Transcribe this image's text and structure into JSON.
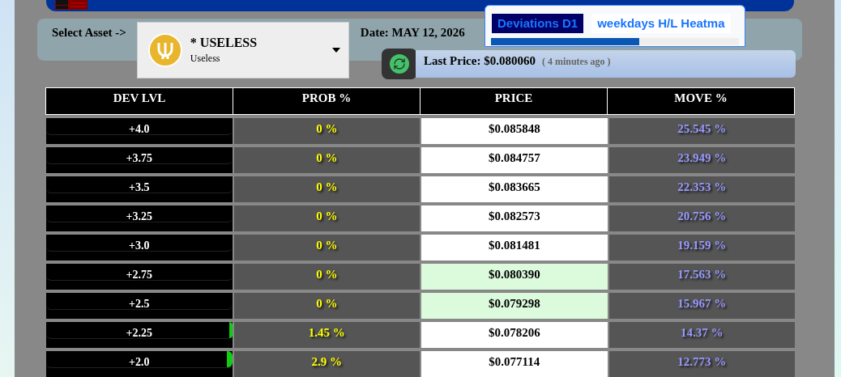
{
  "asset_selector": {
    "label": "Select Asset ->",
    "symbol": "* USELESS",
    "name": "Useless"
  },
  "date": "Date: MAY 12, 2026",
  "tabs": [
    {
      "label": "Deviations D1",
      "selected": true
    },
    {
      "label": "weekdays H/L Heatma",
      "selected": false
    }
  ],
  "last_price": {
    "label": "Last Price: $0.080060",
    "age": "( 4 minutes ago )"
  },
  "table": {
    "columns": [
      "DEV LVL",
      "PROB %",
      "PRICE",
      "MOVE %"
    ],
    "rows": [
      {
        "dev": "+4.0",
        "prob": "0 %",
        "price": "$0.085848",
        "highlighted": false,
        "move": "25.545 %"
      },
      {
        "dev": "+3.75",
        "prob": "0 %",
        "price": "$0.084757",
        "highlighted": false,
        "move": "23.949 %"
      },
      {
        "dev": "+3.5",
        "prob": "0 %",
        "price": "$0.083665",
        "highlighted": false,
        "move": "22.353 %"
      },
      {
        "dev": "+3.25",
        "prob": "0 %",
        "price": "$0.082573",
        "highlighted": false,
        "move": "20.756 %"
      },
      {
        "dev": "+3.0",
        "prob": "0 %",
        "price": "$0.081481",
        "highlighted": false,
        "move": "19.159 %"
      },
      {
        "dev": "+2.75",
        "prob": "0 %",
        "price": "$0.080390",
        "highlighted": true,
        "move": "17.563 %"
      },
      {
        "dev": "+2.5",
        "prob": "0 %",
        "price": "$0.079298",
        "highlighted": true,
        "move": "15.967 %"
      },
      {
        "dev": "+2.25",
        "prob": "1.45 %",
        "level": 0.0145,
        "price": "$0.078206",
        "highlighted": false,
        "move": "14.37 %"
      },
      {
        "dev": "+2.0",
        "prob": "2.9 %",
        "level": 0.029,
        "price": "$0.077114",
        "highlighted": false,
        "move": "12.773 %"
      }
    ]
  }
}
